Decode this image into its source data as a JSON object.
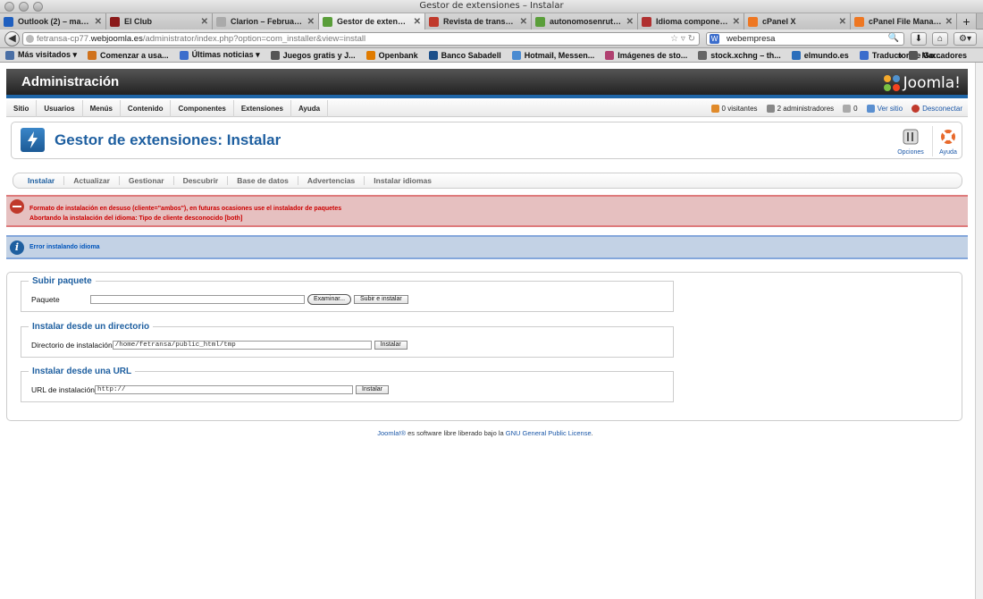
{
  "window": {
    "title": "Gestor de extensiones – Instalar"
  },
  "tabs": [
    {
      "label": "Outlook (2) – maqu...",
      "icon": "outlook-icon",
      "color": "#1f5fbf"
    },
    {
      "label": "El Club",
      "icon": "club-icon",
      "color": "#8b1a1a"
    },
    {
      "label": "Clarion – February ...",
      "icon": "page-icon",
      "color": "#aaaaaa"
    },
    {
      "label": "Gestor de extension...",
      "icon": "x-icon",
      "color": "#5a9e3a",
      "active": true
    },
    {
      "label": "Revista de transpor...",
      "icon": "a-icon",
      "color": "#c0392b"
    },
    {
      "label": "autonomosenruta.c...",
      "icon": "x-icon",
      "color": "#5a9e3a"
    },
    {
      "label": "Idioma componente...",
      "icon": "w-icon",
      "color": "#b03030"
    },
    {
      "label": "cPanel X",
      "icon": "cpanel-icon",
      "color": "#ee7722"
    },
    {
      "label": "cPanel File Manager...",
      "icon": "cpanel-icon",
      "color": "#ee7722"
    }
  ],
  "nav": {
    "url_prefix": "fetransa-cp77.",
    "url_host": "webjoomla.es",
    "url_path": "/administrator/index.php?option=com_installer&view=install",
    "search_value": "webempresa"
  },
  "bookmarks": [
    {
      "label": "Más visitados ▾",
      "color": "#4a6fa5"
    },
    {
      "label": "Comenzar a usa...",
      "color": "#d0721c"
    },
    {
      "label": "Últimas noticias ▾",
      "color": "#3b6dcc"
    },
    {
      "label": "Juegos gratis y J...",
      "color": "#555555"
    },
    {
      "label": "Openbank",
      "color": "#e07b00"
    },
    {
      "label": "Banco Sabadell",
      "color": "#1c4f8a"
    },
    {
      "label": "Hotmail, Messen...",
      "color": "#4a8bd1"
    },
    {
      "label": "Imágenes de sto...",
      "color": "#b04070"
    },
    {
      "label": "stock.xchng – th...",
      "color": "#666666"
    },
    {
      "label": "elmundo.es",
      "color": "#2a6ebb"
    },
    {
      "label": "Traductor de Go...",
      "color": "#3b6dcc"
    }
  ],
  "bookmarks_right": "Marcadores",
  "header": {
    "title": "Administración",
    "logo_text": "Joomla!"
  },
  "menu": [
    "Sitio",
    "Usuarios",
    "Menús",
    "Contenido",
    "Componentes",
    "Extensiones",
    "Ayuda"
  ],
  "status": {
    "visitors": "0 visitantes",
    "admins": "2 administradores",
    "messages": "0",
    "view_site": "Ver sitio",
    "logout": "Desconectar"
  },
  "page": {
    "title": "Gestor de extensiones: Instalar",
    "options_label": "Opciones",
    "help_label": "Ayuda"
  },
  "submenu": [
    "Instalar",
    "Actualizar",
    "Gestionar",
    "Descubrir",
    "Base de datos",
    "Advertencias",
    "Instalar idiomas"
  ],
  "messages": {
    "error_line1": "Formato de instalación en desuso (cliente=\"ambos\"), en futuras ocasiones use el instalador de paquetes",
    "error_line2": "Abortando la instalación del idioma: Tipo de cliente desconocido [both]",
    "notice": "Error instalando idioma"
  },
  "upload": {
    "legend": "Subir paquete",
    "label": "Paquete",
    "browse_label": "Examinar...",
    "submit_label": "Subir e instalar"
  },
  "directory": {
    "legend": "Instalar desde un directorio",
    "label": "Directorio de instalación",
    "value": "/home/fetransa/public_html/tmp",
    "submit_label": "Instalar"
  },
  "url": {
    "legend": "Instalar desde una URL",
    "label": "URL de instalación",
    "value": "http://",
    "submit_label": "Instalar"
  },
  "footer": {
    "joomla_link": "Joomla!®",
    "text": " es software libre liberado bajo la ",
    "license_link": "GNU General Public License",
    "end": "."
  }
}
